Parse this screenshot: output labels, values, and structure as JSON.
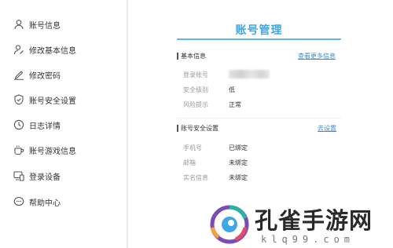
{
  "sidebar": {
    "items": [
      {
        "label": "账号信息",
        "icon": "user-icon"
      },
      {
        "label": "修改基本信息",
        "icon": "user-edit-icon"
      },
      {
        "label": "修改密码",
        "icon": "pencil-icon"
      },
      {
        "label": "账号安全设置",
        "icon": "shield-icon"
      },
      {
        "label": "日志详情",
        "icon": "clock-icon"
      },
      {
        "label": "账号游戏信息",
        "icon": "mug-icon"
      },
      {
        "label": "登录设备",
        "icon": "device-icon"
      },
      {
        "label": "帮助中心",
        "icon": "chat-icon"
      }
    ]
  },
  "main": {
    "title": "账号管理",
    "basic": {
      "heading": "基本信息",
      "link": "查看更多信息",
      "rows": [
        {
          "label": "登录账号",
          "value": ""
        },
        {
          "label": "安全级别",
          "value": "低"
        },
        {
          "label": "风险提示",
          "value": "正常"
        }
      ]
    },
    "security": {
      "heading": "账号安全设置",
      "link": "去设置",
      "rows": [
        {
          "label": "手机号",
          "value": "已绑定"
        },
        {
          "label": "邮箱",
          "value": "未绑定"
        },
        {
          "label": "实名信息",
          "value": "未绑定"
        }
      ]
    }
  },
  "watermark": {
    "name": "孔雀手游网",
    "url": "klq99.com"
  },
  "colors": {
    "accent": "#3ea7e6",
    "link": "#3b8bd4"
  }
}
